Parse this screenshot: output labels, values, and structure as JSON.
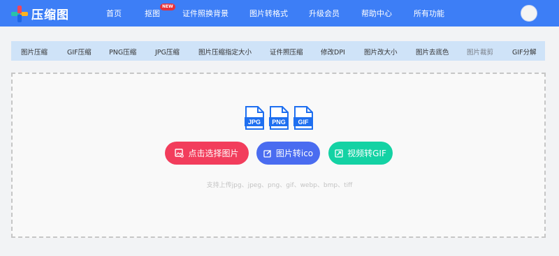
{
  "header": {
    "logo_text": "压缩图",
    "nav": [
      "首页",
      "抠图",
      "证件照换背景",
      "图片转格式",
      "升级会员",
      "帮助中心",
      "所有功能"
    ],
    "new_badge": "NEW"
  },
  "tabs": [
    "图片压缩",
    "GIF压缩",
    "PNG压缩",
    "JPG压缩",
    "图片压缩指定大小",
    "证件照压缩",
    "修改DPI",
    "图片改大小",
    "图片去底色",
    "图片裁剪",
    "GIF分解"
  ],
  "filetypes": [
    "JPG",
    "PNG",
    "GIF"
  ],
  "buttons": {
    "select_image": "点击选择图片",
    "to_ico": "图片转ico",
    "video_to_gif": "视频转GIF"
  },
  "hint": "支持上传jpg、jpeg、png、gif、webp、bmp、tiff",
  "colors": {
    "brand_blue": "#3d7ef6",
    "select_red": "#f23d5c",
    "ico_blue": "#4a6cf0",
    "gif_teal": "#14d2a4",
    "tab_bg": "#cfe3f8"
  }
}
